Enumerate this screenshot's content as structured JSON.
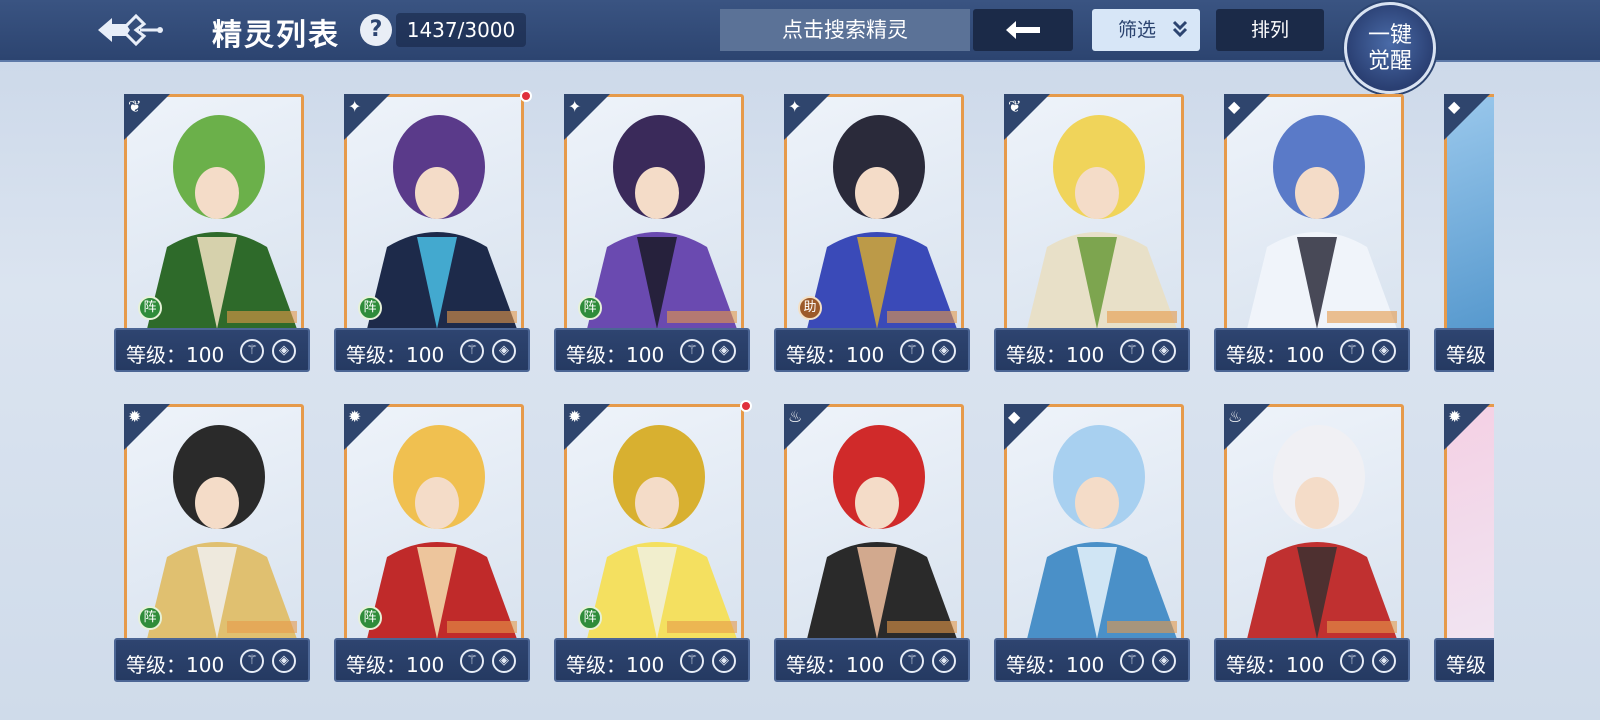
{
  "header": {
    "title": "精灵列表",
    "help": "?",
    "count": "1437/3000",
    "search_placeholder": "点击搜索精灵",
    "filter_label": "筛选",
    "sort_label": "排列",
    "awaken_line1": "一键",
    "awaken_line2": "觉醒"
  },
  "cards": [
    {
      "level": "等级：100",
      "element": "grass",
      "tag": "阵",
      "dot": false,
      "art": [
        "#6bb04a",
        "#2e6a2a",
        "#f3e3c3"
      ]
    },
    {
      "level": "等级：100",
      "element": "demon",
      "tag": "阵",
      "dot": true,
      "art": [
        "#5a3a8a",
        "#1d2a4a",
        "#4ac0e6"
      ]
    },
    {
      "level": "等级：100",
      "element": "demon",
      "tag": "阵",
      "dot": false,
      "art": [
        "#3a2a5a",
        "#6a4ab0",
        "#1a1a28"
      ]
    },
    {
      "level": "等级：100",
      "element": "demon",
      "tag": "助",
      "dot": false,
      "art": [
        "#2a2a3a",
        "#3a4ab8",
        "#d4a834"
      ]
    },
    {
      "level": "等级：100",
      "element": "grass",
      "tag": "",
      "dot": false,
      "art": [
        "#f0d45a",
        "#e8e0c8",
        "#6a9a3a"
      ]
    },
    {
      "level": "等级：100",
      "element": "water",
      "tag": "",
      "dot": false,
      "art": [
        "#5a7ac8",
        "#f0f4fa",
        "#2a2a3a"
      ]
    },
    {
      "level": "等级：100",
      "element": "light",
      "tag": "阵",
      "dot": false,
      "art": [
        "#2a2a2a",
        "#e0c070",
        "#f0f0f0"
      ]
    },
    {
      "level": "等级：100",
      "element": "light",
      "tag": "阵",
      "dot": false,
      "art": [
        "#f0c050",
        "#c02a2a",
        "#f4e0b0"
      ]
    },
    {
      "level": "等级：100",
      "element": "light",
      "tag": "阵",
      "dot": true,
      "art": [
        "#d8b030",
        "#f4e060",
        "#f0f0e0"
      ]
    },
    {
      "level": "等级：100",
      "element": "fire",
      "tag": "",
      "dot": false,
      "art": [
        "#d02a2a",
        "#2a2a2a",
        "#f0c0a0"
      ]
    },
    {
      "level": "等级：100",
      "element": "water",
      "tag": "",
      "dot": false,
      "art": [
        "#a8d0f0",
        "#4a90c8",
        "#e8f4fc"
      ]
    },
    {
      "level": "等级：100",
      "element": "fire",
      "tag": "",
      "dot": false,
      "art": [
        "#f0f0f4",
        "#c03030",
        "#3a3030"
      ]
    }
  ],
  "partial_cards": [
    {
      "level": "等级",
      "element": "water"
    },
    {
      "level": "等级",
      "element": "light"
    }
  ],
  "icons": {
    "grass": "❦",
    "demon": "✦",
    "water": "◆",
    "light": "✹",
    "fire": "♨"
  }
}
